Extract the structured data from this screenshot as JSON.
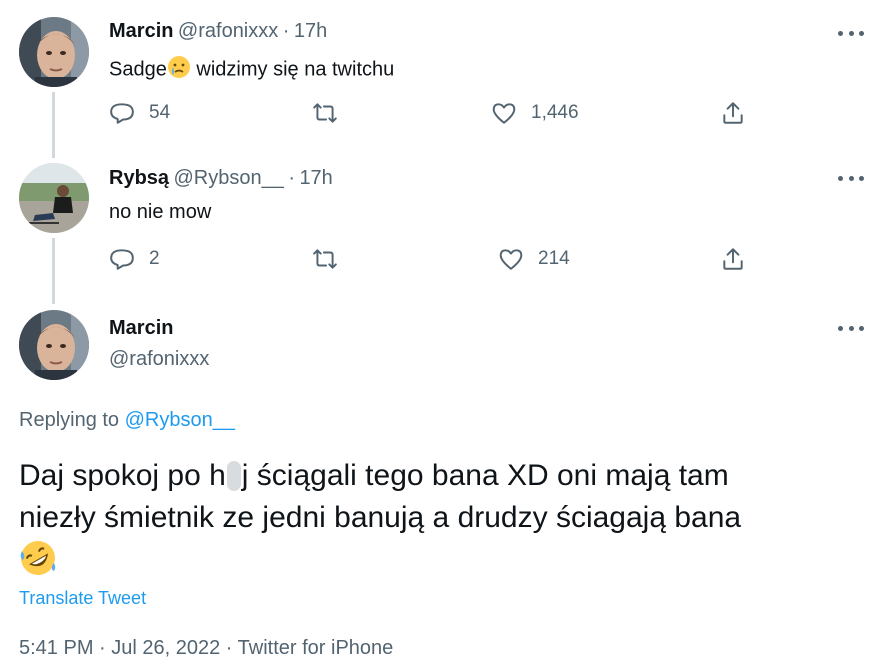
{
  "tweets": [
    {
      "name": "Marcin",
      "handle": "@rafonixxx",
      "separator": "·",
      "time": "17h",
      "text_before_emoji": "Sadge",
      "text_after_emoji": " widzimy się na twitchu",
      "replies": "54",
      "likes": "1,446",
      "emoji_icon": "crying-face-icon"
    },
    {
      "name": "Rybsą",
      "handle": "@Rybson__",
      "separator": "·",
      "time": "17h",
      "text": "no nie mow",
      "replies": "2",
      "likes": "214"
    }
  ],
  "main_tweet": {
    "name": "Marcin",
    "handle": "@rafonixxx",
    "replying_prefix": "Replying to",
    "replying_to": "@Rybson__",
    "line1_start": "Daj spokoj po h",
    "line1_end": "j ściągali tego bana XD oni mają tam",
    "line2": "niezły śmietnik ze jedni banują a drudzy ściagają bana",
    "emoji_icon": "rolling-on-floor-laughing-icon",
    "translate_label": "Translate Tweet",
    "timestamp": "5:41 PM · Jul 26, 2022 · ",
    "source": "Twitter for iPhone"
  },
  "colors": {
    "text": "#0f1419",
    "secondary": "#536471",
    "link": "#1d9bf0",
    "thread_line": "#cfd9de"
  }
}
